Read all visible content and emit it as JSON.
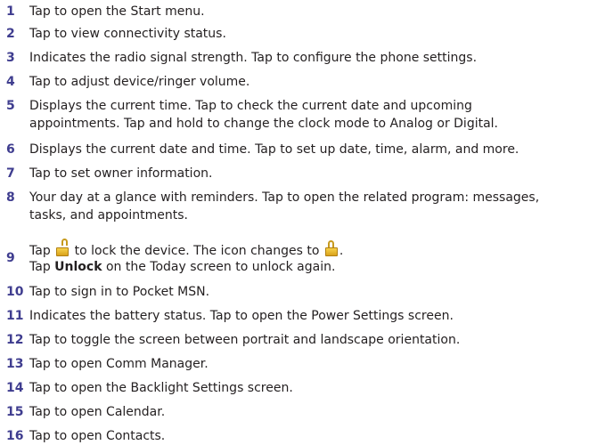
{
  "items": [
    {
      "num": "1",
      "lines": [
        "Tap to open the Start menu."
      ]
    },
    {
      "num": "2",
      "lines": [
        "Tap to view connectivity status."
      ]
    },
    {
      "num": "3",
      "lines": [
        "Indicates the radio signal strength. Tap to configure the phone settings."
      ]
    },
    {
      "num": "4",
      "lines": [
        "Tap to adjust device/ringer volume."
      ]
    },
    {
      "num": "5",
      "lines": [
        "Displays the current time. Tap to check the current date and upcoming",
        "appointments. Tap and hold to change the clock mode to Analog or Digital."
      ]
    },
    {
      "num": "6",
      "lines": [
        "Displays the current date and time. Tap to set up date, time, alarm, and more."
      ]
    },
    {
      "num": "7",
      "lines": [
        "Tap to set owner information."
      ]
    },
    {
      "num": "8",
      "lines": [
        "Your day at a glance with reminders. Tap to open the related program: messages,",
        "tasks, and appointments."
      ]
    },
    {
      "num": "9",
      "lock": {
        "pre": "Tap",
        "mid": "to lock the device. The icon changes to",
        "post": ".",
        "line2_pre": "Tap",
        "line2_bold": "Unlock",
        "line2_post": "on the Today screen to unlock again.",
        "icon_open": "unlocked-padlock-icon",
        "icon_closed": "locked-padlock-icon"
      }
    },
    {
      "num": "10",
      "lines": [
        "Tap to sign in to Pocket MSN."
      ]
    },
    {
      "num": "11",
      "lines": [
        "Indicates the battery status. Tap to open the Power Settings screen."
      ]
    },
    {
      "num": "12",
      "lines": [
        "Tap to toggle the screen between portrait and landscape orientation."
      ]
    },
    {
      "num": "13",
      "lines": [
        "Tap to open Comm Manager."
      ]
    },
    {
      "num": "14",
      "lines": [
        "Tap to open the Backlight Settings screen."
      ]
    },
    {
      "num": "15",
      "lines": [
        "Tap to open Calendar."
      ]
    },
    {
      "num": "16",
      "lines": [
        "Tap to open Contacts."
      ]
    }
  ],
  "colors": {
    "number": "#3f3d8f",
    "text": "#231f20",
    "icon": "#f2c232"
  }
}
